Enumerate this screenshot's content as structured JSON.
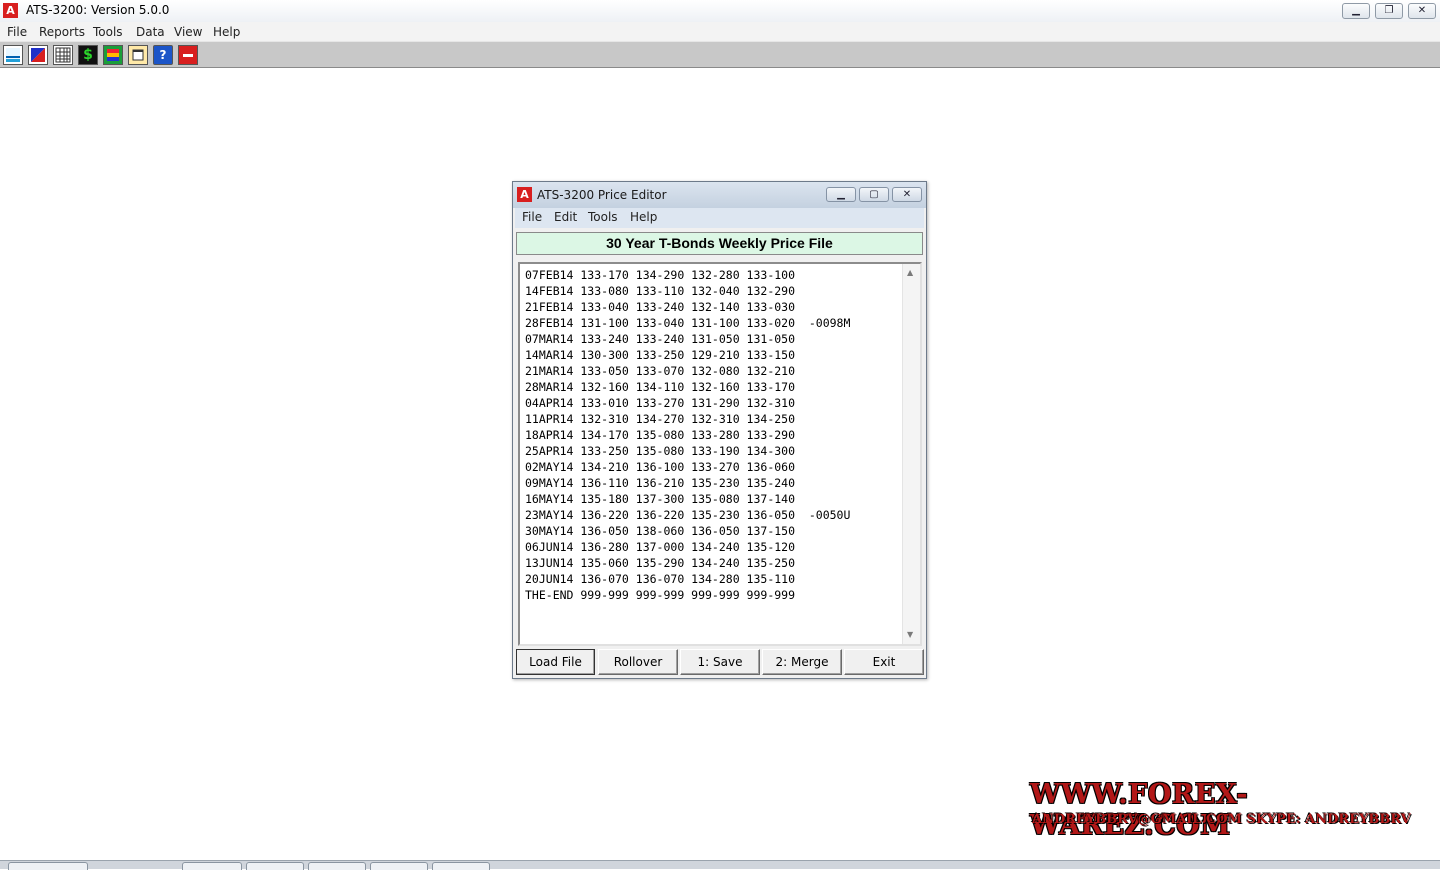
{
  "app": {
    "title": "ATS-3200: Version 5.0.0",
    "icon_letter": "A",
    "window_buttons": [
      "minimize-icon",
      "restore-icon",
      "close-icon"
    ]
  },
  "menu": [
    "File",
    "Reports",
    "Tools",
    "Data",
    "View",
    "Help"
  ],
  "toolbar": {
    "buttons": [
      "chart-icon",
      "line-chart-icon",
      "grid-table-icon",
      "dollar-icon",
      "color-bars-icon",
      "window-icon",
      "help-icon",
      "stop-icon"
    ],
    "dollar_glyph": "$",
    "help_glyph": "?"
  },
  "dialog": {
    "title": "ATS-3200 Price Editor",
    "menu": [
      "File",
      "Edit",
      "Tools",
      "Help"
    ],
    "header": "30 Year T-Bonds Weekly Price File",
    "lines": [
      "07FEB14 133-170 134-290 132-280 133-100",
      "14FEB14 133-080 133-110 132-040 132-290",
      "21FEB14 133-040 133-240 132-140 133-030",
      "28FEB14 131-100 133-040 131-100 133-020  -0098M",
      "07MAR14 133-240 133-240 131-050 131-050",
      "14MAR14 130-300 133-250 129-210 133-150",
      "21MAR14 133-050 133-070 132-080 132-210",
      "28MAR14 132-160 134-110 132-160 133-170",
      "04APR14 133-010 133-270 131-290 132-310",
      "11APR14 132-310 134-270 132-310 134-250",
      "18APR14 134-170 135-080 133-280 133-290",
      "25APR14 133-250 135-080 133-190 134-300",
      "02MAY14 134-210 136-100 133-270 136-060",
      "09MAY14 136-110 136-210 135-230 135-240",
      "16MAY14 135-180 137-300 135-080 137-140",
      "23MAY14 136-220 136-220 135-230 136-050  -0050U",
      "30MAY14 136-050 138-060 136-050 137-150",
      "06JUN14 136-280 137-000 134-240 135-120",
      "13JUN14 135-060 135-290 134-240 135-250",
      "20JUN14 136-070 136-070 134-280 135-110",
      "THE-END 999-999 999-999 999-999 999-999"
    ],
    "buttons": [
      "Load File",
      "Rollover",
      "1: Save",
      "2: Merge",
      "Exit"
    ]
  },
  "watermark": {
    "site": "WWW.FOREX-WAREZ.COM",
    "contact": "ANDREYBBRV@GMAIL.COM  SKYPE: ANDREYBBRV"
  },
  "colors": {
    "header_bg": "#dcf7e5",
    "toolbar_bg": "#c8c8c8",
    "icon_red": "#d81f1f",
    "watermark_red": "#b21818"
  }
}
